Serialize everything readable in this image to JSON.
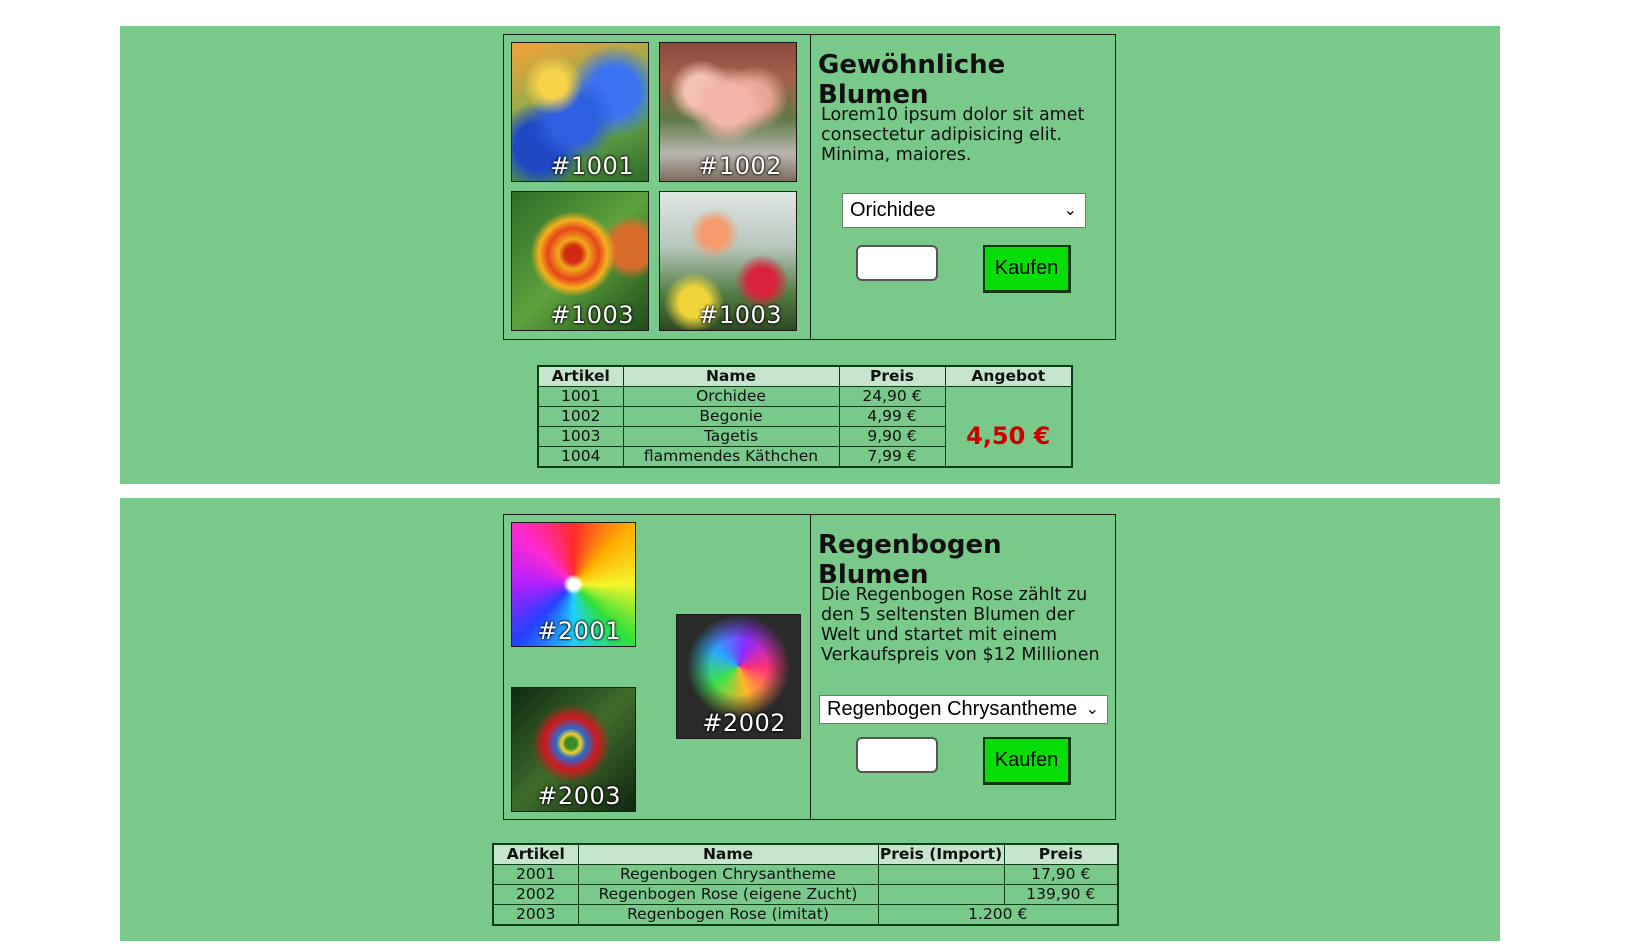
{
  "sections": [
    {
      "title": "Gewöhnliche Blumen",
      "description": "Lorem10 ipsum dolor sit amet consectetur adipisicing elit. Minima, maiores.",
      "images": [
        {
          "tag": "#1001",
          "icon": "blue-orchid-photo"
        },
        {
          "tag": "#1002",
          "icon": "pink-begonia-photo"
        },
        {
          "tag": "#1003",
          "icon": "orange-marigold-photo"
        },
        {
          "tag": "#1003",
          "icon": "flaming-katy-photo"
        }
      ],
      "select_value": "Orichidee",
      "buy_label": "Kaufen",
      "table": {
        "headers": [
          "Artikel",
          "Name",
          "Preis",
          "Angebot"
        ],
        "rows": [
          [
            "1001",
            "Orchidee",
            "24,90 €"
          ],
          [
            "1002",
            "Begonie",
            "4,99 €"
          ],
          [
            "1003",
            "Tagetis",
            "9,90 €"
          ],
          [
            "1004",
            "flammendes Käthchen",
            "7,99 €"
          ]
        ],
        "offer": "4,50 €"
      }
    },
    {
      "title": "Regenbogen Blumen",
      "description": "Die Regenbogen Rose zählt zu den 5 seltensten Blumen der Welt und startet mit einem Verkaufspreis von $12 Millionen",
      "images": [
        {
          "tag": "#2001",
          "icon": "rainbow-chrysanthemum-photo"
        },
        {
          "tag": "#2002",
          "icon": "rainbow-rose-photo"
        },
        {
          "tag": "#2003",
          "icon": "rainbow-rose-red-photo"
        }
      ],
      "select_value": "Regenbogen Chrysantheme",
      "buy_label": "Kaufen",
      "table": {
        "headers": [
          "Artikel",
          "Name",
          "Preis (Import)",
          "Preis"
        ],
        "rows": [
          [
            "2001",
            "Regenbogen Chrysantheme",
            "",
            "17,90 €"
          ],
          [
            "2002",
            "Regenbogen Rose (eigene Zucht)",
            "",
            "139,90 €"
          ],
          [
            "2003",
            "Regenbogen Rose (imitat)",
            "1.200 €"
          ]
        ]
      }
    }
  ],
  "colors": {
    "section_bg": "#79c98a",
    "header_bg": "#c5e6cc",
    "buy_button": "#07dd07",
    "offer_text": "#cc0000"
  }
}
